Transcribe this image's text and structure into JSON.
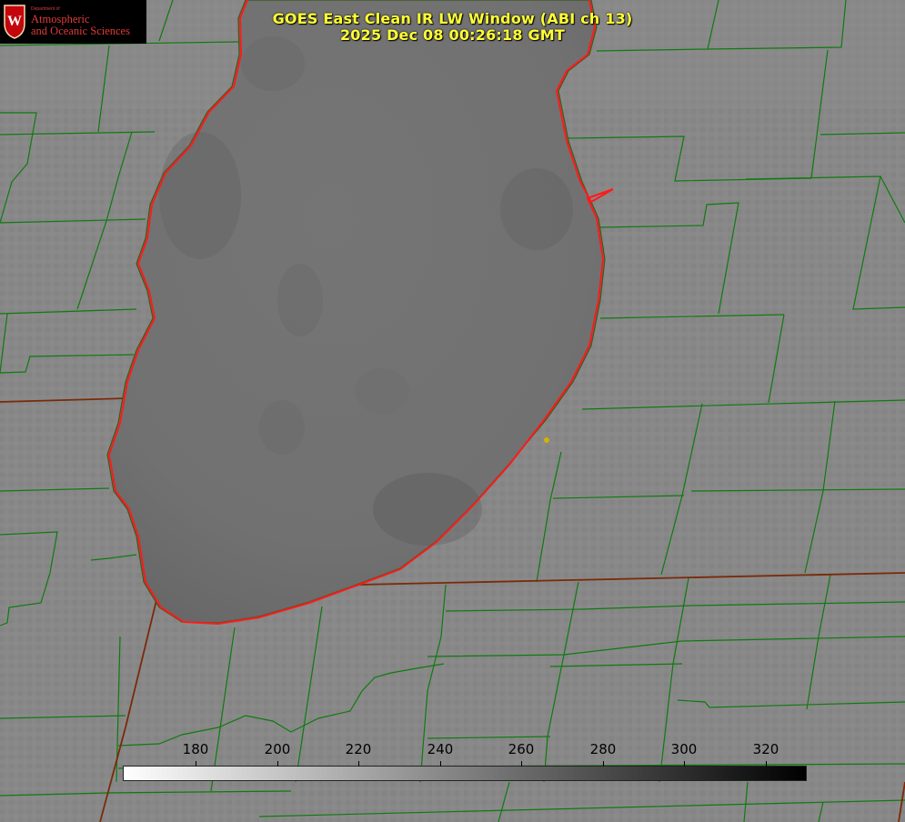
{
  "header": {
    "title": "GOES East Clean IR LW Window (ABI ch 13)",
    "datetime": "2025 Dec 08 00:26:18 GMT"
  },
  "logo": {
    "small_text": "Department of",
    "line1": "Atmospheric",
    "line2": "and Oceanic Sciences",
    "crest_letter": "W"
  },
  "colorbar": {
    "ticks": [
      "180",
      "200",
      "220",
      "240",
      "260",
      "280",
      "300",
      "320"
    ],
    "gradient_start": "#ffffff",
    "gradient_end": "#000000"
  },
  "colors": {
    "land": "#888888",
    "lake": "#6e6e6e",
    "county_borders": "#0f7a0f",
    "coastline": "#ff1a1a",
    "state_borders": "#7a2a08",
    "title_text": "#ffff33",
    "marker": "#d4b400"
  },
  "map": {
    "feature": "Lake Michigan (satellite IR view)",
    "marker_color": "#d4b400"
  }
}
